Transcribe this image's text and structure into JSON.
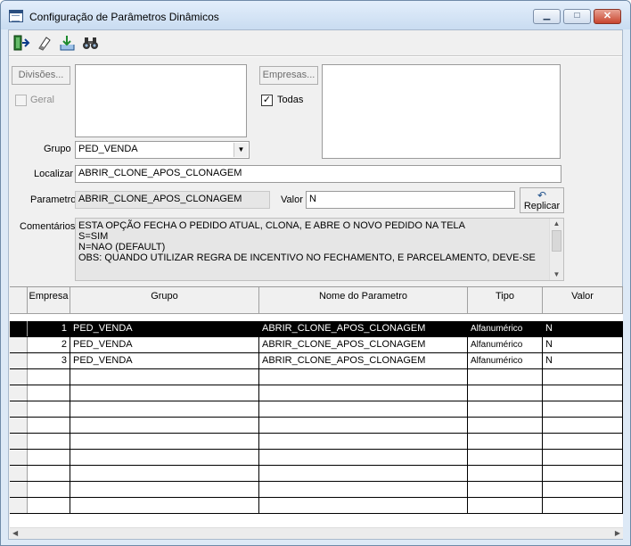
{
  "window": {
    "title": "Configuração de Parâmetros Dinâmicos"
  },
  "toolbar": {
    "exit_icon": "exit-door-icon",
    "clear_icon": "eraser-icon",
    "save_icon": "save-tray-icon",
    "search_icon": "binoculars-icon"
  },
  "divisoes_button": "Divisões...",
  "geral_label": "Geral",
  "empresas_button": "Empresas...",
  "todas_label": "Todas",
  "grupo": {
    "label": "Grupo",
    "value": "PED_VENDA"
  },
  "localizar": {
    "label": "Localizar",
    "value": "ABRIR_CLONE_APOS_CLONAGEM"
  },
  "parametro": {
    "label": "Parametro",
    "value": "ABRIR_CLONE_APOS_CLONAGEM"
  },
  "valor": {
    "label": "Valor",
    "value": "N"
  },
  "replicar_button": "Replicar",
  "comentarios": {
    "label": "Comentários",
    "lines": [
      "ESTA OPÇÃO FECHA O PEDIDO ATUAL, CLONA, E ABRE O NOVO PEDIDO NA TELA",
      "S=SIM",
      "N=NAO (DEFAULT)",
      "OBS: QUANDO UTILIZAR REGRA DE INCENTIVO NO FECHAMENTO, E PARCELAMENTO, DEVE-SE"
    ]
  },
  "grid": {
    "columns": [
      "Empresa",
      "Grupo",
      "Nome do Parametro",
      "Tipo",
      "Valor"
    ],
    "rows": [
      [
        "1",
        "PED_VENDA",
        "ABRIR_CLONE_APOS_CLONAGEM",
        "Alfanumérico",
        "N"
      ],
      [
        "2",
        "PED_VENDA",
        "ABRIR_CLONE_APOS_CLONAGEM",
        "Alfanumérico",
        "N"
      ],
      [
        "3",
        "PED_VENDA",
        "ABRIR_CLONE_APOS_CLONAGEM",
        "Alfanumérico",
        "N"
      ]
    ],
    "selected_row": 0
  }
}
